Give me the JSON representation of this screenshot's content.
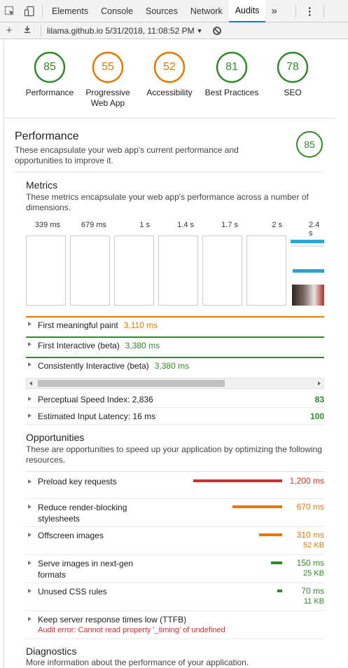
{
  "devtools": {
    "tabs": [
      "Elements",
      "Console",
      "Sources",
      "Network",
      "Audits"
    ],
    "active_tab": "Audits",
    "more_label": "»",
    "menu_label": "⋮"
  },
  "audit_bar": {
    "report_title": "lilama.github.io 5/31/2018, 11:08:52 PM",
    "dropdown_glyph": "▼"
  },
  "summary": [
    {
      "label": "Performance",
      "score": "85",
      "score_value": 85,
      "color": "#2e8b28"
    },
    {
      "label": "Progressive\nWeb App",
      "score": "55",
      "score_value": 55,
      "color": "#e67700"
    },
    {
      "label": "Accessibility",
      "score": "52",
      "score_value": 52,
      "color": "#e67700"
    },
    {
      "label": "Best Practices",
      "score": "81",
      "score_value": 81,
      "color": "#2e8b28"
    },
    {
      "label": "SEO",
      "score": "78",
      "score_value": 78,
      "color": "#2e8b28"
    }
  ],
  "performance": {
    "title": "Performance",
    "description": "These encapsulate your web app's current performance and opportunities to improve it.",
    "score": "85",
    "score_value": 85
  },
  "metrics": {
    "title": "Metrics",
    "description": "These metrics encapsulate your web app's performance across a number of dimensions.",
    "filmstrip_times": [
      "339 ms",
      "679 ms",
      "1 s",
      "1.4 s",
      "1.7 s",
      "2 s",
      "2.4 s"
    ],
    "timeline": [
      {
        "label": "First meaningful paint",
        "value": "3,110 ms",
        "color": "#e67700"
      },
      {
        "label": "First Interactive (beta)",
        "value": "3,380 ms",
        "color": "#2e8b28"
      },
      {
        "label": "Consistently Interactive (beta)",
        "value": "3,380 ms",
        "color": "#2e8b28"
      }
    ],
    "other": [
      {
        "label": "Perceptual Speed Index: 2,836",
        "score": "83"
      },
      {
        "label": "Estimated Input Latency: 16 ms",
        "score": "100"
      }
    ]
  },
  "opportunities": {
    "title": "Opportunities",
    "description": "These are opportunities to speed up your application by optimizing the following resources.",
    "items": [
      {
        "label": "Preload key requests",
        "value": "1,200 ms",
        "size": "",
        "color": "#d32f2f",
        "share": 1.0
      },
      {
        "label": "Reduce render-blocking stylesheets",
        "value": "670 ms",
        "size": "",
        "color": "#e67700",
        "share": 0.56
      },
      {
        "label": "Offscreen images",
        "value": "310 ms",
        "size": "52 KB",
        "color": "#e67700",
        "share": 0.26
      },
      {
        "label": "Serve images in next-gen formats",
        "value": "150 ms",
        "size": "25 KB",
        "color": "#2e8b28",
        "share": 0.13
      },
      {
        "label": "Unused CSS rules",
        "value": "70 ms",
        "size": "11 KB",
        "color": "#2e8b28",
        "share": 0.06
      }
    ],
    "error_item": {
      "label": "Keep server response times low (TTFB)",
      "error": "Audit error: Cannot read property '_timing' of undefined"
    }
  },
  "diagnostics": {
    "title": "Diagnostics",
    "description": "More information about the performance of your application."
  }
}
